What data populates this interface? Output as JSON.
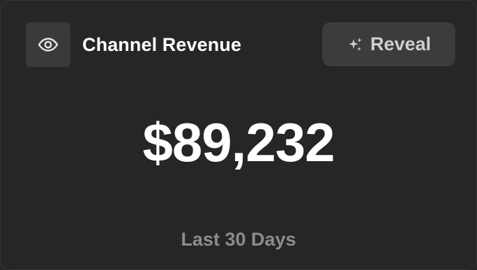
{
  "card": {
    "title": "Channel Revenue",
    "reveal_label": "Reveal",
    "value": "$89,232",
    "period": "Last 30 Days",
    "icons": {
      "visibility": "eye-icon",
      "reveal": "sparkles-icon"
    }
  },
  "colors": {
    "background": "#262626",
    "icon_box": "#3a3a3c",
    "button": "#3c3c3f",
    "primary_text": "#ffffff",
    "muted_text": "#8c8c8e"
  }
}
